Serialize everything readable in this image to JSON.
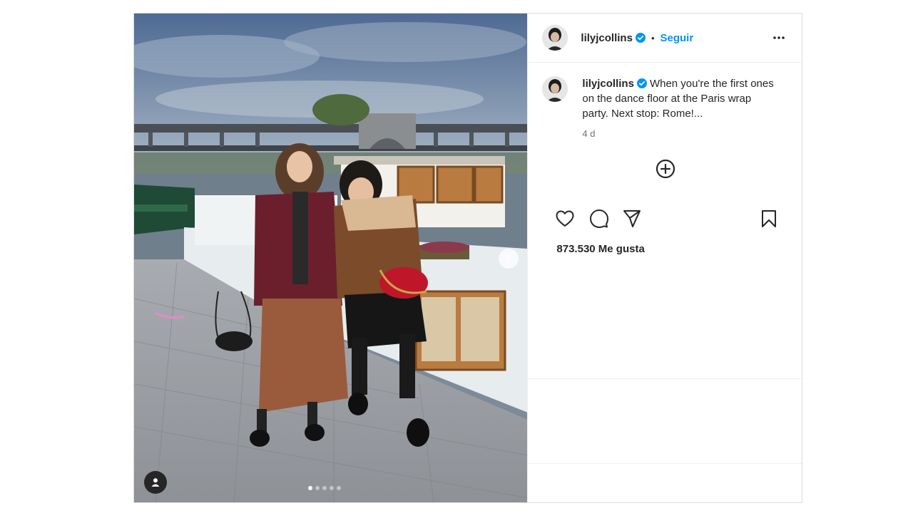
{
  "post": {
    "username": "lilyjcollins",
    "follow_label": "Seguir",
    "separator": "•",
    "caption_text": "When you're the first ones on the dance floor at the Paris wrap party. Next stop: Rome!...",
    "timestamp": "4 d",
    "likes": "873.530 Me gusta",
    "carousel_dots": 5,
    "carousel_active_index": 0
  },
  "icons": {
    "verified": "verified-badge-icon",
    "more": "more-options-icon",
    "add_comment": "add-comment-icon",
    "like": "heart-icon",
    "comment": "comment-icon",
    "share": "send-icon",
    "save": "bookmark-icon",
    "next": "chevron-right-icon",
    "tag": "user-tag-icon"
  },
  "colors": {
    "accent": "#0095f6",
    "text": "#262626",
    "muted": "#737373",
    "border": "#dbdbdb"
  }
}
